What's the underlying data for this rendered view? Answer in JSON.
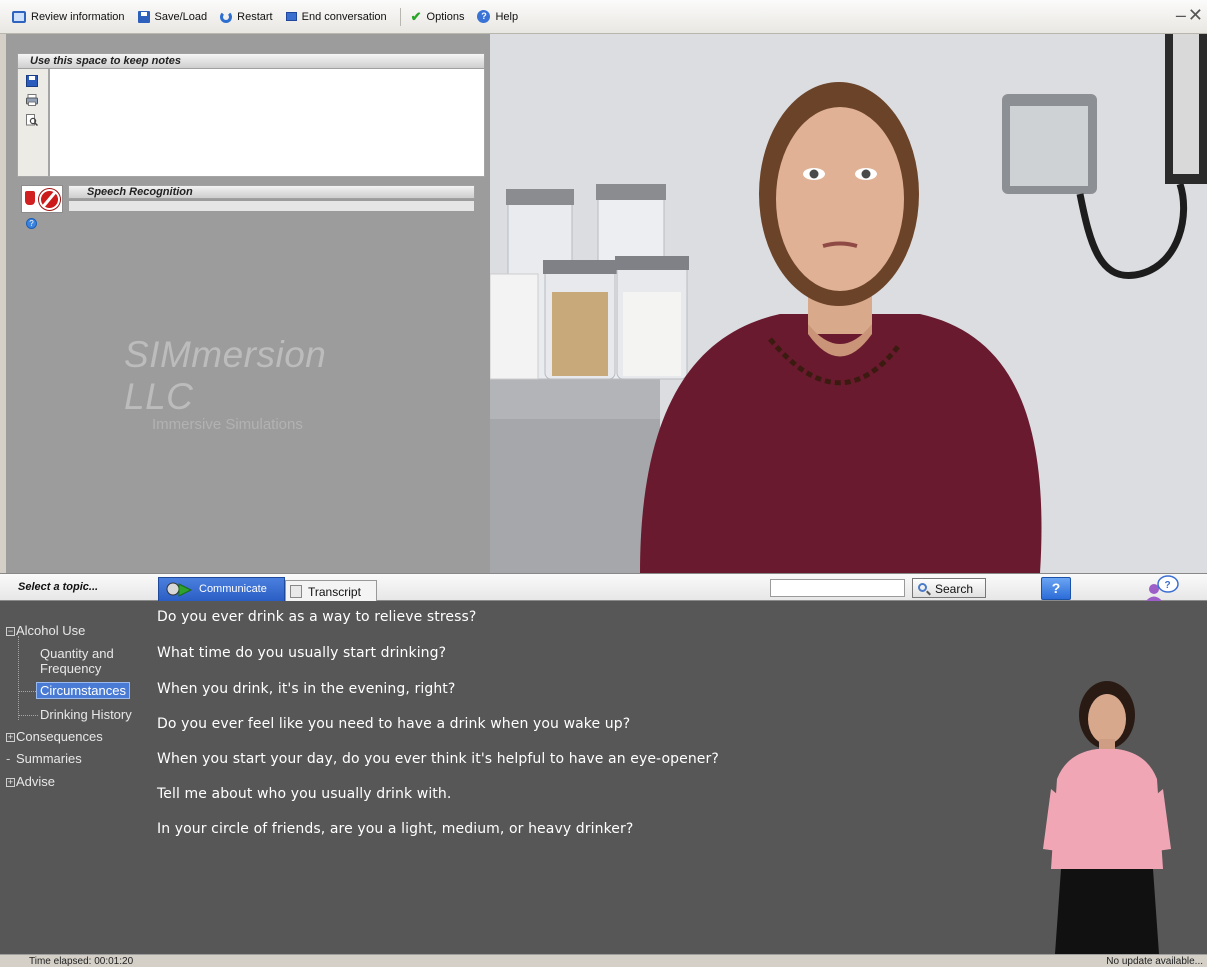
{
  "menubar": {
    "items": [
      {
        "label": "Review information",
        "icon": "book-icon"
      },
      {
        "label": "Save/Load",
        "icon": "disk-icon"
      },
      {
        "label": "Restart",
        "icon": "restart-icon"
      },
      {
        "label": "End conversation",
        "icon": "end-icon"
      },
      {
        "label": "Options",
        "icon": "check-icon"
      },
      {
        "label": "Help",
        "icon": "help-icon"
      }
    ],
    "window_controls": [
      "minimize-icon",
      "close-icon"
    ]
  },
  "notes": {
    "header": "Use this space to keep notes",
    "content": "",
    "tools": [
      "save-icon",
      "print-icon",
      "preview-icon"
    ]
  },
  "speech": {
    "header": "Speech Recognition"
  },
  "logo": {
    "main": "SIMmersion LLC",
    "sub": "Immersive Simulations"
  },
  "topicbar": {
    "select_label": "Select a topic...",
    "tabs": [
      {
        "label": "Communicate",
        "active": true
      },
      {
        "label": "Transcript",
        "active": false
      }
    ],
    "search_value": "",
    "search_label": "Search",
    "help_label": "?"
  },
  "topics": {
    "alcohol_use": "Alcohol Use",
    "quantity": "Quantity and",
    "frequency": "Frequency",
    "circumstances": "Circumstances",
    "drinking_history": "Drinking History",
    "consequences": "Consequences",
    "summaries": "Summaries",
    "advise": "Advise",
    "selected": "Circumstances"
  },
  "questions": [
    "Do you ever drink as a way to relieve stress?",
    "What time do you usually start drinking?",
    "When you drink, it's in the evening, right?",
    "Do you ever feel like you need to have a drink when you wake up?",
    "When you start your day, do you ever think it's helpful to have an eye-opener?",
    "Tell me about who you usually drink with.",
    "In your circle of friends, are you a light, medium, or heavy drinker?"
  ],
  "status": {
    "time_elapsed": "Time elapsed: 00:01:20",
    "update": "No update available..."
  },
  "colors": {
    "accent": "#2a5ec4",
    "lower_panel": "#575757",
    "left_panel": "#9c9c9c",
    "selected_topic": "#4a7bd4"
  }
}
